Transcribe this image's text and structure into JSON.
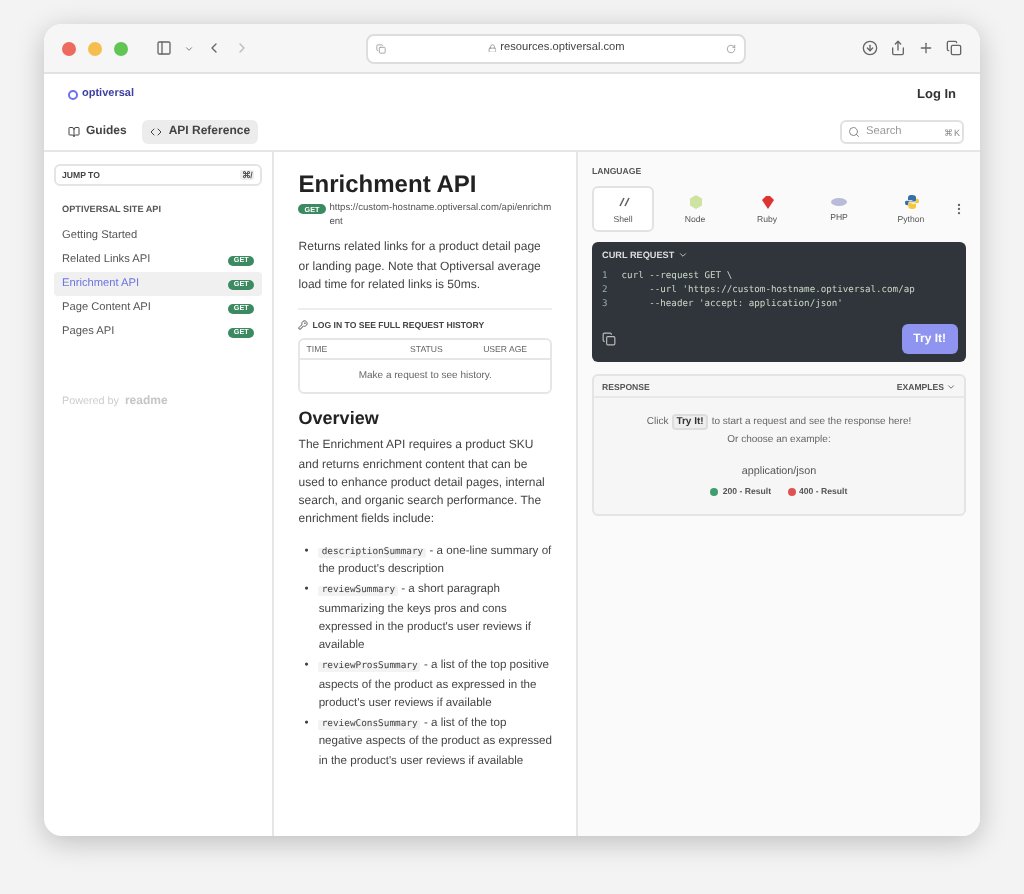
{
  "browser": {
    "url": "resources.optiversal.com"
  },
  "site": {
    "logo": "optiversal",
    "login": "Log In"
  },
  "nav": {
    "tabs": [
      {
        "label": "Guides",
        "selected": false
      },
      {
        "label": "API Reference",
        "selected": true
      }
    ],
    "search": {
      "placeholder": "Search",
      "shortcut": "⌘K"
    }
  },
  "sidebar": {
    "jump_to": "JUMP TO",
    "jump_shortcut": "⌘/",
    "section": "OPTIVERSAL SITE API",
    "items": [
      {
        "label": "Getting Started",
        "selected": false
      },
      {
        "label": "Related Links API",
        "method": "GET",
        "selected": false
      },
      {
        "label": "Enrichment API",
        "method": "GET",
        "selected": true
      },
      {
        "label": "Page Content API",
        "method": "GET",
        "selected": false
      },
      {
        "label": "Pages API",
        "method": "GET",
        "selected": false
      }
    ],
    "powered_by": "Powered by",
    "brand": "readme"
  },
  "main": {
    "title": "Enrichment API",
    "method": "GET",
    "url": "https://custom-hostname.optiversal.com/api/enrichment",
    "description": "Returns related links for a product detail page or landing page. Note that Optiversal average load time for related links is 50ms.",
    "history_link": "LOG IN TO SEE FULL REQUEST HISTORY",
    "history_columns": [
      "TIME",
      "STATUS",
      "USER AGE"
    ],
    "history_empty": "Make a request to see history.",
    "overview_heading": "Overview",
    "overview": "The Enrichment API requires a product SKU and returns enrichment content that can be used to enhance product detail pages, internal search, and organic search performance. The enrichment fields include:",
    "fields": [
      {
        "marker": "•",
        "code": "descriptionSummary",
        "text": "- a one-line summary of the product's description"
      },
      {
        "marker": "•",
        "code": "reviewSummary",
        "text": "- a short paragraph summarizing the keys pros and cons expressed in the product's user reviews if available"
      },
      {
        "marker": "•",
        "code": "reviewProsSummary",
        "text": "- a list of the top positive aspects of the product as expressed in the product's user reviews if available"
      },
      {
        "marker": "•",
        "code": "reviewConsSummary",
        "text": "- a list of the top negative aspects of the product as expressed in the product's user reviews if available"
      }
    ]
  },
  "right": {
    "language_label": "LANGUAGE",
    "languages": [
      {
        "label": "Shell",
        "selected": true
      },
      {
        "label": "Node",
        "selected": false
      },
      {
        "label": "Ruby",
        "selected": false
      },
      {
        "label": "PHP",
        "selected": false
      },
      {
        "label": "Python",
        "selected": false
      }
    ],
    "request": {
      "title": "CURL REQUEST",
      "lines": [
        {
          "number": "1",
          "text": "curl --request GET \\"
        },
        {
          "number": "2",
          "text": "     --url 'https://custom-hostname.optiversal.com/ap"
        },
        {
          "number": "3",
          "text": "     --header 'accept: application/json'"
        }
      ],
      "try": "Try It!"
    },
    "response": {
      "title": "RESPONSE",
      "examples": "EXAMPLES",
      "hint_before": "Click",
      "hint_button": "Try It!",
      "hint_after": "to start a request and see the response here!",
      "hint_line2": "Or choose an example:",
      "content_type": "application/json",
      "results": [
        {
          "label": "200 - Result",
          "color": "#3f9e6e"
        },
        {
          "label": "400 - Result",
          "color": "#e05252"
        }
      ]
    }
  }
}
